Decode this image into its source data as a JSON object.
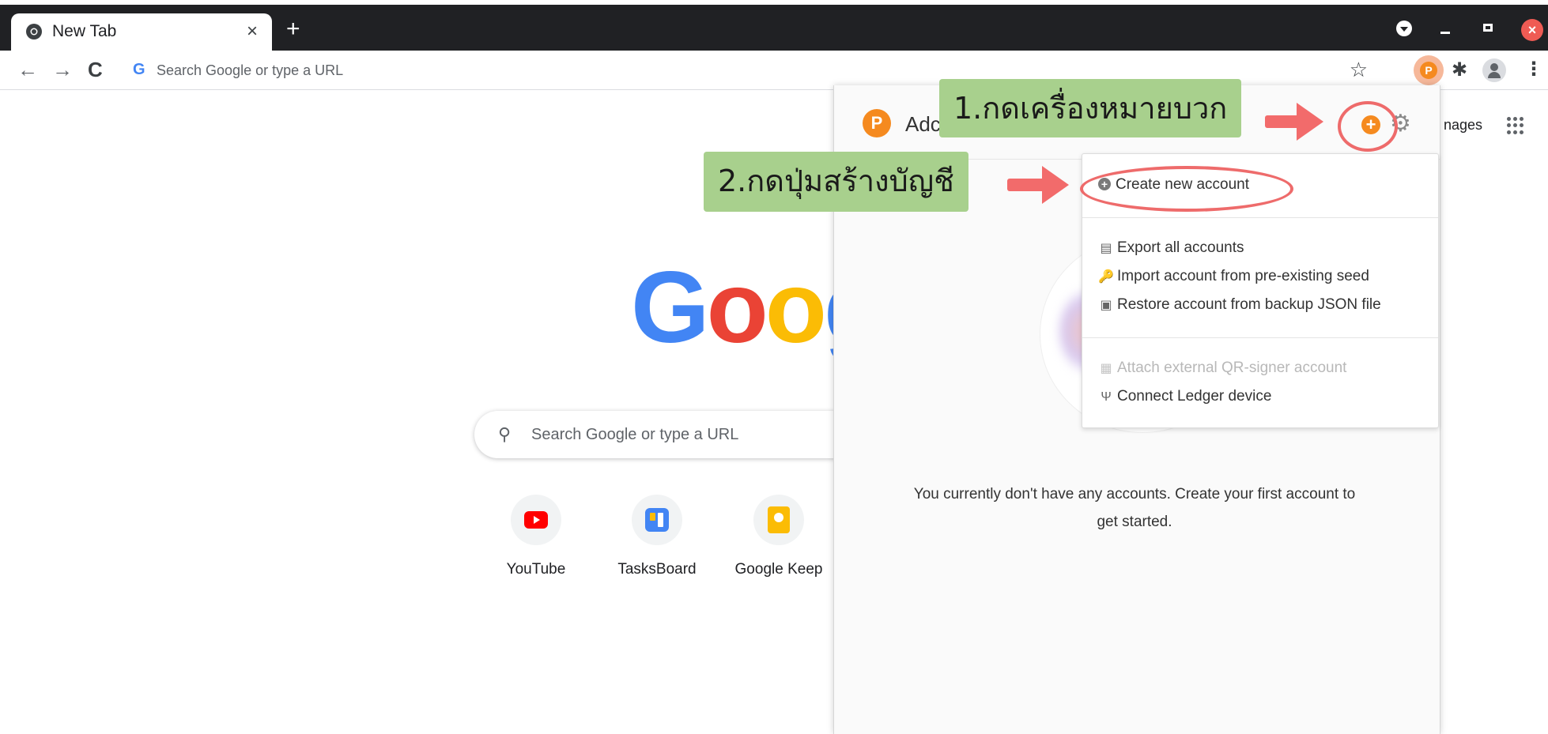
{
  "browser": {
    "tab_title": "New Tab",
    "tab_close": "×",
    "new_tab": "+",
    "nav_back": "←",
    "nav_forward": "→",
    "nav_reload": "C",
    "omnibox_placeholder": "Search Google or type a URL",
    "omnibox_g": "G",
    "bookmark_star": "☆",
    "extension_badge": "P",
    "puzzle": "✱",
    "kebab": "⋮",
    "window_close": "×"
  },
  "newtab": {
    "images_link": "nages",
    "logo_letters": [
      "G",
      "o",
      "o",
      "g"
    ],
    "search_placeholder": "Search Google or type a URL",
    "search_icon": "⚲",
    "shortcuts": [
      {
        "label": "YouTube",
        "icon": "youtube-icon"
      },
      {
        "label": "TasksBoard",
        "icon": "tasksboard-icon"
      },
      {
        "label": "Google Keep",
        "icon": "keep-icon"
      }
    ]
  },
  "popup": {
    "logo": "P",
    "title": "Adc",
    "add_symbol": "+",
    "gear": "⚙",
    "empty_message": "You currently don't have any accounts. Create your first account to get started.",
    "menu": {
      "create": "Create new account",
      "export": "Export all accounts",
      "import": "Import account from pre-existing seed",
      "restore": "Restore account from backup JSON file",
      "attach_qr": "Attach external QR-signer account",
      "ledger": "Connect Ledger device"
    },
    "menu_icons": {
      "export": "▤",
      "import": "🔑",
      "restore": "▣",
      "attach_qr": "▦",
      "ledger": "Ψ"
    }
  },
  "annotations": {
    "step1": "1.กดเครื่องหมายบวก",
    "step2": "2.กดปุ่มสร้างบัญชี",
    "highlight_color": "#ee6b6b",
    "callout_color": "#a8d08d"
  }
}
